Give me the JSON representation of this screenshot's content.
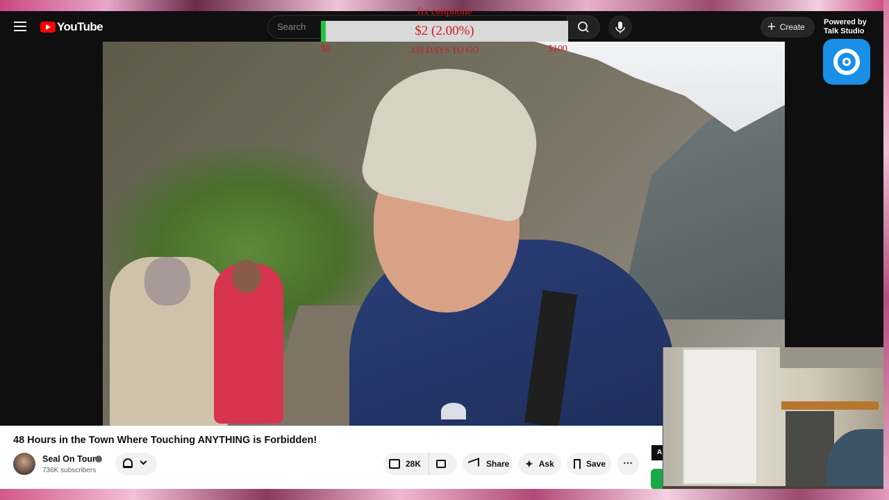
{
  "header": {
    "logo_text": "YouTube",
    "search_placeholder": "Search",
    "create_label": "Create"
  },
  "donation_goal": {
    "title": "fix cellphone",
    "amount_text": "$2 (2.00%)",
    "progress_percent": 2,
    "min_label": "$0",
    "days_label": "339 DAYS TO GO",
    "max_label": "$100",
    "colors": {
      "text": "#d11b1b",
      "fill": "#22c43a",
      "track": "#d9d9d9"
    }
  },
  "overlay": {
    "powered_line1": "Powered by",
    "powered_line2": "Talk Studio",
    "brand_color": "#1a8fe8"
  },
  "video": {
    "title": "48 Hours in the Town Where Touching ANYTHING is Forbidden!",
    "channel_name": "Seal On Tour",
    "subscribers": "736K subscribers",
    "like_count": "28K",
    "share_label": "Share",
    "ask_label": "Ask",
    "save_label": "Save",
    "more_label": "⋯",
    "side_button_label": "A"
  },
  "icons": {
    "menu": "hamburger-icon",
    "search": "search-icon",
    "mic": "microphone-icon",
    "bell": "bell-icon",
    "like": "thumbs-up-icon",
    "dislike": "thumbs-down-icon",
    "share": "share-icon",
    "ask": "sparkle-icon",
    "save": "bookmark-icon"
  }
}
